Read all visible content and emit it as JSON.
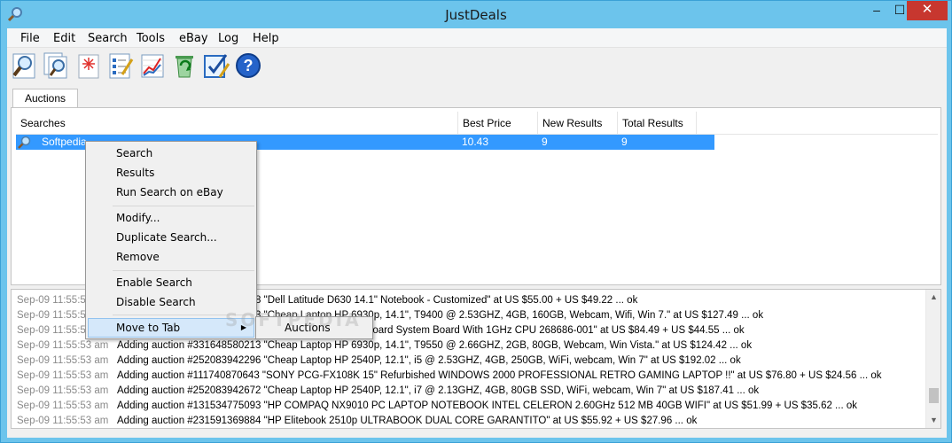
{
  "window": {
    "title": "JustDeals",
    "min_glyph": "–",
    "max_glyph": "☐",
    "close_glyph": "✕"
  },
  "menubar": [
    "File",
    "Edit",
    "Search",
    "Tools",
    "eBay",
    "Log",
    "Help"
  ],
  "toolbar": {
    "icons": [
      "search-icon",
      "results-icon",
      "run-search-icon",
      "modify-list-icon",
      "chart-icon",
      "recycle-bin-icon",
      "checklist-icon",
      "help-icon"
    ]
  },
  "tabs": [
    "Auctions"
  ],
  "grid": {
    "columns": [
      "Searches",
      "Best Price",
      "New Results",
      "Total Results"
    ],
    "rows": [
      {
        "name": "Softpedia",
        "best_price": "10.43",
        "new_results": "9",
        "total_results": "9",
        "selected": true
      }
    ],
    "selection_color": "#3399ff"
  },
  "context_menu": {
    "items": [
      "Search",
      "Results",
      "Run Search on eBay",
      "Modify...",
      "Duplicate Search...",
      "Remove",
      "Enable Search",
      "Disable Search",
      "Move to Tab"
    ],
    "submenu_items": [
      "Auctions"
    ]
  },
  "log": {
    "lines": [
      {
        "time": "Sep-09 11:55:53 am",
        "msg": "Adding auction #251588459098 \"Dell Latitude D630 14.1\" Notebook - Customized\" at US $55.00 + US $49.22 ... ok"
      },
      {
        "time": "Sep-09 11:55:53 am",
        "msg": "Adding auction #331648580213 \"Cheap Laptop  HP 6930p, 14.1\", T9400 @ 2.53GHZ, 4GB, 160GB, Webcam, Wifi, Win 7.\" at US $127.49 ... ok"
      },
      {
        "time": "Sep-09 11:55:53 am",
        "msg": "Adding auction #231591369883 \"HP Motherboard Mainboard System Board With 1GHz CPU 268686-001\" at US $84.49 + US $44.55 ... ok"
      },
      {
        "time": "Sep-09 11:55:53 am",
        "msg": "Adding auction #331648580213 \"Cheap Laptop  HP 6930p, 14.1\", T9550 @ 2.66GHZ, 2GB, 80GB, Webcam, Win Vista.\" at US $124.42 ... ok"
      },
      {
        "time": "Sep-09 11:55:53 am",
        "msg": "Adding auction #252083942296 \"Cheap Laptop  HP 2540P, 12.1\", i5  @ 2.53GHZ, 4GB, 250GB, WiFi, webcam, Win 7\" at US $192.02 ... ok"
      },
      {
        "time": "Sep-09 11:55:53 am",
        "msg": "Adding auction #111740870643 \"SONY PCG-FX108K 15\" Refurbished WINDOWS 2000 PROFESSIONAL RETRO GAMING LAPTOP !!\" at US $76.80 + US $24.56 ... ok"
      },
      {
        "time": "Sep-09 11:55:53 am",
        "msg": "Adding auction #252083942672 \"Cheap Laptop  HP 2540P, 12.1\", i7  @ 2.13GHZ, 4GB, 80GB SSD, WiFi, webcam, Win 7\" at US $187.41 ... ok"
      },
      {
        "time": "Sep-09 11:55:53 am",
        "msg": "Adding auction #131534775093 \"HP COMPAQ NX9010 PC LAPTOP NOTEBOOK INTEL CELERON 2.60GHz 512 MB 40GB WIFI\" at US $51.99 + US $35.62 ... ok"
      },
      {
        "time": "Sep-09 11:55:53 am",
        "msg": "Adding auction #231591369884 \"HP Elitebook 2510p ULTRABOOK DUAL CORE  GARANTITO\" at US $55.92 + US $27.96 ... ok"
      }
    ]
  },
  "watermark": "SOFTPEDIA"
}
